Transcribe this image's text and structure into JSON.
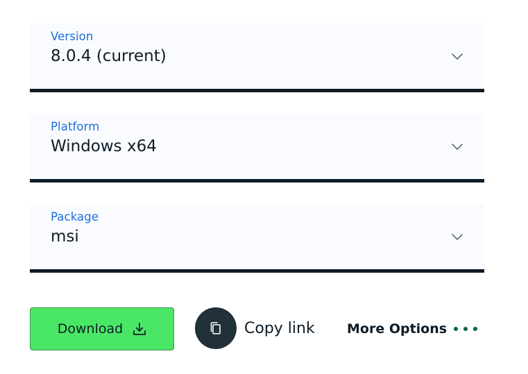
{
  "version_select": {
    "label": "Version",
    "value": "8.0.4 (current)"
  },
  "platform_select": {
    "label": "Platform",
    "value": "Windows x64"
  },
  "package_select": {
    "label": "Package",
    "value": "msi"
  },
  "actions": {
    "download_label": "Download",
    "copy_link_label": "Copy link",
    "more_options_label": "More Options"
  },
  "icons": {
    "chevron": "chevron-down-icon",
    "download": "download-icon",
    "copy": "copy-icon",
    "more": "more-dots-icon"
  },
  "colors": {
    "label_blue": "#1a6ed8",
    "text_dark": "#0e1c26",
    "download_green": "#4ae766",
    "copy_circle": "#213039",
    "dots_green": "#00684a"
  }
}
